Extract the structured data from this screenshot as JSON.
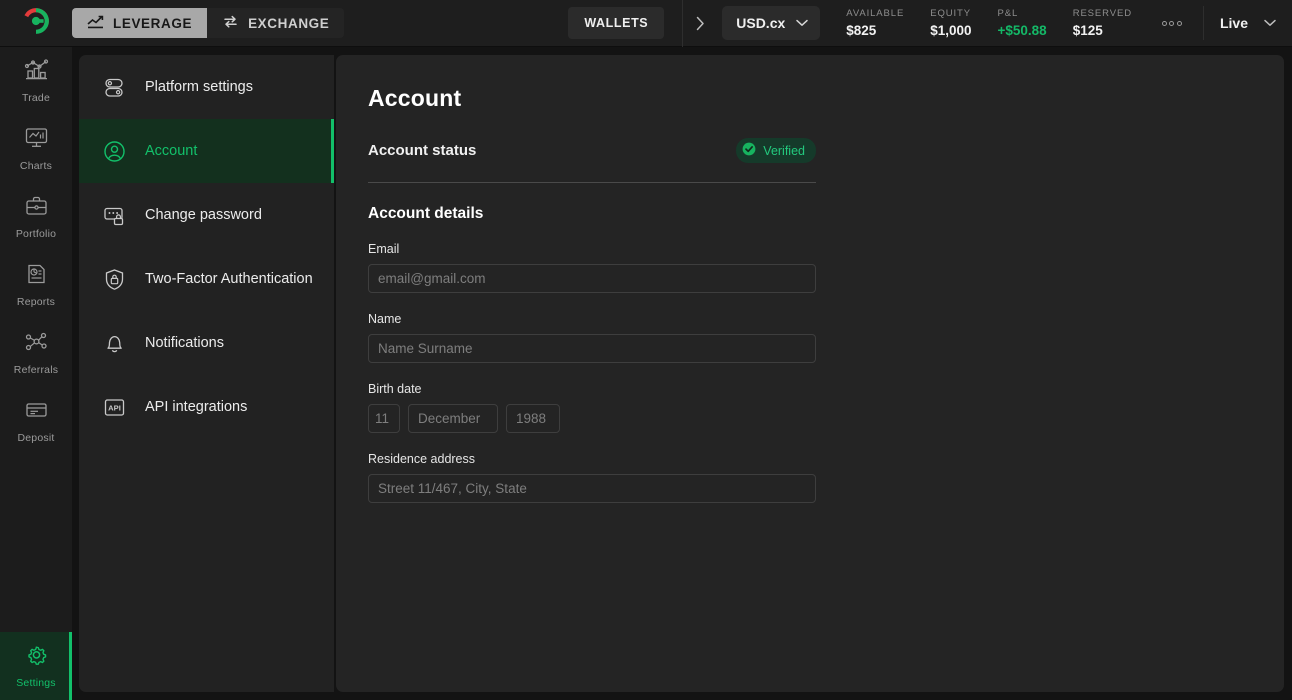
{
  "topbar": {
    "logo_icon": "brand-logo-icon",
    "mode_tabs": [
      {
        "label": "LEVERAGE",
        "icon": "trend-up-icon",
        "active": true
      },
      {
        "label": "EXCHANGE",
        "icon": "swap-arrows-icon",
        "active": false
      }
    ],
    "wallets_label": "WALLETS",
    "chevron_right_icon": "chevron-right-icon",
    "currency": {
      "label": "USD.cx",
      "chevron_icon": "chevron-down-icon"
    },
    "stats": [
      {
        "key": "AVAILABLE",
        "value": "$825",
        "positive": false
      },
      {
        "key": "EQUITY",
        "value": "$1,000",
        "positive": false
      },
      {
        "key": "P&L",
        "value": "+$50.88",
        "positive": true
      },
      {
        "key": "RESERVED",
        "value": "$125",
        "positive": false
      }
    ],
    "more_icon": "more-dots-icon",
    "environment": {
      "label": "Live",
      "chevron_icon": "chevron-down-icon"
    }
  },
  "rail": {
    "items": [
      {
        "label": "Trade",
        "icon": "trade-chart-icon",
        "active": false
      },
      {
        "label": "Charts",
        "icon": "monitor-chart-icon",
        "active": false
      },
      {
        "label": "Portfolio",
        "icon": "briefcase-icon",
        "active": false
      },
      {
        "label": "Reports",
        "icon": "report-document-icon",
        "active": false
      },
      {
        "label": "Referrals",
        "icon": "network-nodes-icon",
        "active": false
      },
      {
        "label": "Deposit",
        "icon": "credit-card-icon",
        "active": false
      }
    ],
    "footer": {
      "label": "Settings",
      "icon": "gear-icon",
      "active": true
    }
  },
  "settings_menu": {
    "items": [
      {
        "label": "Platform settings",
        "icon": "toggles-icon",
        "active": false
      },
      {
        "label": "Account",
        "icon": "user-circle-icon",
        "active": true
      },
      {
        "label": "Change password",
        "icon": "keyboard-lock-icon",
        "active": false
      },
      {
        "label": "Two-Factor Authentication",
        "icon": "shield-lock-icon",
        "active": false
      },
      {
        "label": "Notifications",
        "icon": "bell-icon",
        "active": false
      },
      {
        "label": "API integrations",
        "icon": "api-box-icon",
        "active": false
      }
    ]
  },
  "main": {
    "title": "Account",
    "status": {
      "label": "Account status",
      "badge_text": "Verified",
      "badge_icon": "check-circle-icon"
    },
    "details_title": "Account details",
    "fields": {
      "email": {
        "label": "Email",
        "placeholder": "email@gmail.com",
        "value": ""
      },
      "name": {
        "label": "Name",
        "placeholder": "Name Surname",
        "value": ""
      },
      "birth_date": {
        "label": "Birth date",
        "day_placeholder": "11",
        "month_placeholder": "December",
        "year_placeholder": "1988",
        "day_value": "",
        "month_value": "",
        "year_value": ""
      },
      "residence": {
        "label": "Residence address",
        "placeholder": "Street 11/467, City, State",
        "value": ""
      }
    }
  },
  "colors": {
    "accent_green": "#12c06a",
    "badge_green": "#23c97e",
    "positive": "#14b867",
    "logo_red": "#e33b3b",
    "panel_bg": "#242424",
    "menu_bg": "#222222"
  }
}
